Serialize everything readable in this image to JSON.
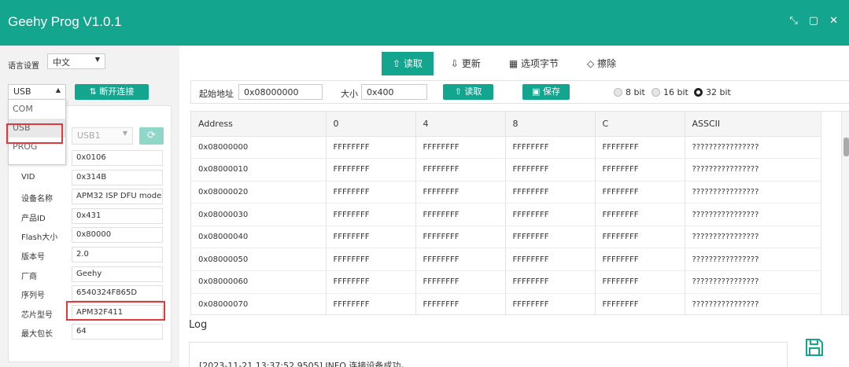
{
  "app": {
    "title": "Geehy Prog V1.0.1"
  },
  "window_controls": {
    "shrink": "⤡",
    "maximize": "▢",
    "close": "✕"
  },
  "language": {
    "label": "语言设置",
    "value": "中文"
  },
  "interface": {
    "value": "USB",
    "disconnect_label": "断开连接",
    "options": [
      "COM",
      "USB",
      "PROG"
    ],
    "selected": "USB"
  },
  "device": {
    "select_value": "USB1",
    "props": [
      {
        "label": "",
        "value": "0x0106"
      },
      {
        "label": "VID",
        "value": "0x314B"
      },
      {
        "label": "设备名称",
        "value": "APM32 ISP DFU mode"
      },
      {
        "label": "产品ID",
        "value": "0x431"
      },
      {
        "label": "Flash大小",
        "value": "0x80000"
      },
      {
        "label": "版本号",
        "value": "2.0"
      },
      {
        "label": "厂商",
        "value": "Geehy"
      },
      {
        "label": "序列号",
        "value": "6540324F865D"
      },
      {
        "label": "芯片型号",
        "value": "APM32F411"
      },
      {
        "label": "最大包长",
        "value": "64"
      }
    ]
  },
  "tabs": [
    {
      "label": "读取",
      "icon": "upload-icon",
      "active": true
    },
    {
      "label": "更新",
      "icon": "download-icon",
      "active": false
    },
    {
      "label": "选项字节",
      "icon": "grid-icon",
      "active": false
    },
    {
      "label": "擦除",
      "icon": "eraser-icon",
      "active": false
    }
  ],
  "toolbar": {
    "start_label": "起始地址",
    "start_value": "0x08000000",
    "size_label": "大小",
    "size_value": "0x400",
    "read_label": "读取",
    "save_label": "保存",
    "bits": [
      {
        "label": "8 bit",
        "on": false
      },
      {
        "label": "16 bit",
        "on": false
      },
      {
        "label": "32 bit",
        "on": true
      }
    ]
  },
  "table": {
    "headers": [
      "Address",
      "0",
      "4",
      "8",
      "C",
      "ASSCII"
    ],
    "rows": [
      [
        "0x08000000",
        "FFFFFFFF",
        "FFFFFFFF",
        "FFFFFFFF",
        "FFFFFFFF",
        "????????????????"
      ],
      [
        "0x08000010",
        "FFFFFFFF",
        "FFFFFFFF",
        "FFFFFFFF",
        "FFFFFFFF",
        "????????????????"
      ],
      [
        "0x08000020",
        "FFFFFFFF",
        "FFFFFFFF",
        "FFFFFFFF",
        "FFFFFFFF",
        "????????????????"
      ],
      [
        "0x08000030",
        "FFFFFFFF",
        "FFFFFFFF",
        "FFFFFFFF",
        "FFFFFFFF",
        "????????????????"
      ],
      [
        "0x08000040",
        "FFFFFFFF",
        "FFFFFFFF",
        "FFFFFFFF",
        "FFFFFFFF",
        "????????????????"
      ],
      [
        "0x08000050",
        "FFFFFFFF",
        "FFFFFFFF",
        "FFFFFFFF",
        "FFFFFFFF",
        "????????????????"
      ],
      [
        "0x08000060",
        "FFFFFFFF",
        "FFFFFFFF",
        "FFFFFFFF",
        "FFFFFFFF",
        "????????????????"
      ],
      [
        "0x08000070",
        "FFFFFFFF",
        "FFFFFFFF",
        "FFFFFFFF",
        "FFFFFFFF",
        "????????????????"
      ]
    ]
  },
  "log": {
    "title": "Log",
    "lines": [
      "[2023-11-21 13:37:52.9505] INFO 连接设备成功。"
    ]
  },
  "colors": {
    "accent": "#13a58e",
    "highlight": "#e0393e"
  }
}
